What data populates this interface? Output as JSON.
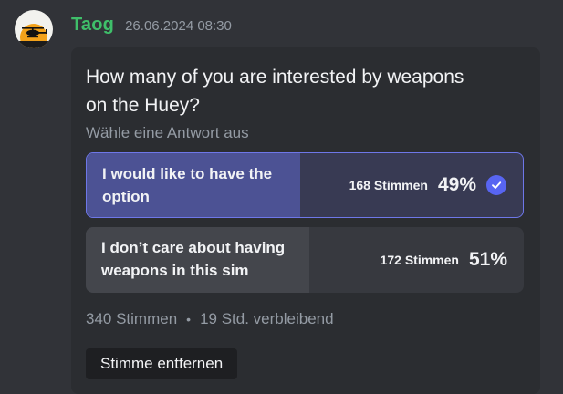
{
  "message": {
    "username": "Taog",
    "timestamp": "26.06.2024 08:30",
    "avatar_icon": "helicopter-sunset-icon"
  },
  "poll": {
    "question": "How many of you are interested by weapons on the Huey?",
    "instruction": "Wähle eine Antwort aus",
    "answers": [
      {
        "label": "I would like to have the option",
        "votes": "168 Stimmen",
        "percent": "49%",
        "fraction": 0.49,
        "selected": true
      },
      {
        "label": "I don’t care about having weapons in this sim",
        "votes": "172 Stimmen",
        "percent": "51%",
        "fraction": 0.51,
        "selected": false
      }
    ],
    "total_votes": "340 Stimmen",
    "separator": "•",
    "time_remaining": "19 Std. verbleibend",
    "remove_vote_label": "Stimme entfernen"
  },
  "colors": {
    "username": "#3fbf6a",
    "accent": "#5865f2"
  }
}
